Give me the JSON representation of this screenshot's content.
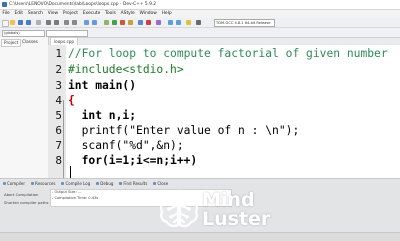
{
  "window": {
    "title": "C:\\Users\\LENOVO\\Documents\\lab\\Loops\\loops.cpp - Dev-C++ 5.9.2"
  },
  "menu": [
    "File",
    "Edit",
    "Search",
    "View",
    "Project",
    "Execute",
    "Tools",
    "AStyle",
    "Window",
    "Help"
  ],
  "toolbar": {
    "compiler": "TDM-GCC 4.8.1 64-bit Release",
    "globals": "(globals)"
  },
  "left_panel": {
    "tabs": [
      "Project",
      "Classes"
    ]
  },
  "editor": {
    "file_tab": "loops.cpp",
    "line_numbers": [
      "1",
      "2",
      "3",
      "4",
      "5",
      "6",
      "7",
      "8"
    ],
    "lines": [
      "//For loop to compute factorial of given number",
      "#include<stdio.h>",
      "int main()",
      "{",
      "  int n,i;",
      "  printf(\"Enter value of n : \\n\");",
      "  scanf(\"%d\",&n);",
      "  for(i=1;i<=n;i++)"
    ]
  },
  "bottom_panel": {
    "tabs": [
      "Compiler",
      "Resources",
      "Compile Log",
      "Debug",
      "Find Results",
      "Close"
    ],
    "abort_label": "Abort Compilation",
    "shorten_label": "Shorten compiler paths",
    "log_lines": [
      "- Output Size: ...",
      "- Compilation Time: 0.43s"
    ]
  },
  "watermark": {
    "line1": "Mind",
    "line2": "Luster"
  },
  "colors": {
    "comment": "#2e8b57",
    "string": "#1a1acc",
    "preprocessor": "#1e7a25",
    "logo_text": "#ffffff"
  }
}
